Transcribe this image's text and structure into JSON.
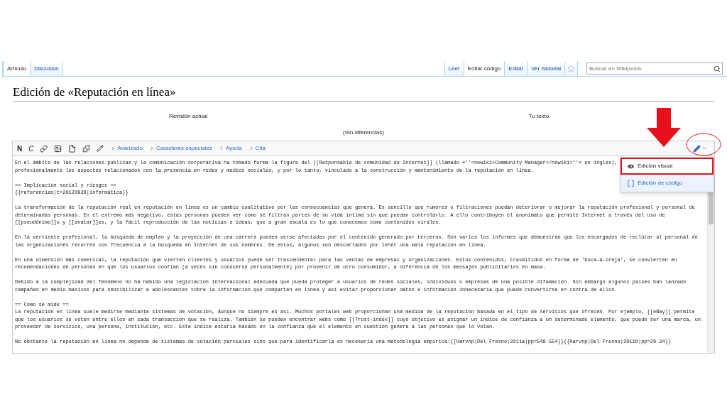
{
  "tabs_left": [
    {
      "label": "Artículo",
      "selected": true
    },
    {
      "label": "Discusión",
      "selected": false
    }
  ],
  "tabs_right": [
    {
      "label": "Leer",
      "selected": false
    },
    {
      "label": "Editar código",
      "selected": true
    },
    {
      "label": "Editar",
      "selected": false
    },
    {
      "label": "Ver historial",
      "selected": false
    }
  ],
  "search": {
    "placeholder": "Buscar en Wikipedia"
  },
  "title": "Edición de «Reputación en línea»",
  "diff": {
    "left_header": "Revisión actual",
    "right_header": "Tu texto",
    "message": "(Sin diferencias)"
  },
  "toolbar": {
    "bold": "N",
    "italic": "C",
    "menus": [
      "Avanzado",
      "Caracteres especiales",
      "Ayuda",
      "Cita"
    ]
  },
  "editor_menu": [
    {
      "kind": "visual",
      "label": "Edición visual",
      "highlighted": true
    },
    {
      "kind": "code",
      "label": "Edición de código",
      "highlighted": false
    }
  ],
  "annotations": {
    "arrow": true,
    "ellipse": true
  },
  "paragraphs": [
    [
      "En el ámbito de las relaciones públicas y la comunicación corporativa ha tomado forma la figura del [[Responsable de comunidad de Internet]] (llamado «''<nowiki>Community Manager</nowiki>''» en inglés),",
      "profesionalmente los aspectos relacionados con la presencia en redes y medios sociales, y por lo tanto, vinculado a la construcción y mantenimiento de la reputación en línea."
    ],
    [
      "== Implicación social y riesgos ==",
      "{{referencias|t=20120926|informática}}"
    ],
    [
      "La transformación de la reputación real en reputación en línea es un cambio cualitativo por las consecuencias que genera. Es sencillo que rumores o filtraciones puedan deteriorar o mejorar la reputación profesional y personal de",
      "determinadas personas. En el extremo más negativo, estas personas pueden ver cómo se filtran partes de su vida íntima sin que puedan controlarlo. A ello contribuyen el anonimato que permite Internet a través del uso de",
      "[[pseudónimo]]s y [[avatar]]es, y la fácil reproducción de las noticias e ideas, que a gran escala es lo que conocemos como contenidos virales."
    ],
    [
      "En la vertiente profesional, la búsqueda de empleo y la proyección de una carrera pueden verse afectadas por el contenido generado por terceros. Son varios los informes que demuestran que los encargados de reclutar al personal de",
      "las organizaciones recurren con frecuencia a la búsqueda en Internet de sus nombres. De estos, algunos son descartados por tener una mala reputación en línea."
    ],
    [
      "En una dimensión más comercial, la reputación que vierten clientes y usuarios puede ser trascendental para las ventas de empresas y organizaciones. Estos contenidos, trasmitidos en forma de 'boca-a-oreja', se convierten en",
      "recomendaciones de personas en que los usuarios confían (a veces sin conocerse personalmente) por provenir de otro consumidor, a diferencia de los mensajes publicitarios en masa."
    ],
    [
      "Debido a la complejidad del fenómeno no ha habido una legislación internacional adecuada que pueda proteger a usuarios de redes sociales, individuos o empresas de una posible difamación. Sin embargo algunos países han lanzado",
      "campañas en medio masivos para sensibilizar a adolescentes sobre la información que comparten en línea y así evitar proporcionar datos e información innecesaria que puede convertirse en contra de ellos."
    ],
    [
      "== Cómo se mide ==",
      "La reputación en línea suele medirse mediante sistemas de votación, Aunque no siempre es así. Muchos portales web proporcionan una medida de la reputación basada en el tipo de servicios que ofrecen. Por ejemplo, [[eBay]] permite",
      "que los usuarios se voten entre ellos en cada transacción que se realiza. También se pueden encontrar webs como [[Trust-index]] cuyo objetivo es asignar un índice de confianza a un determinado elemento, que puede ser una marca, un",
      "proveedor de servicios, una persona, institución, etc. Este índice estaría basado en la confianza que el elemento en cuestión genera a las personas que lo votan."
    ],
    [
      "No obstante la reputación en línea no depende de sistemas de votación parciales sino que para identificarla es necesaria una metodología empírica:{{Harvnp|Del Fresno|2011a|pp=548-554}}{{Harvnp|Del Fresno|2011b|pp=29-34}}"
    ]
  ]
}
